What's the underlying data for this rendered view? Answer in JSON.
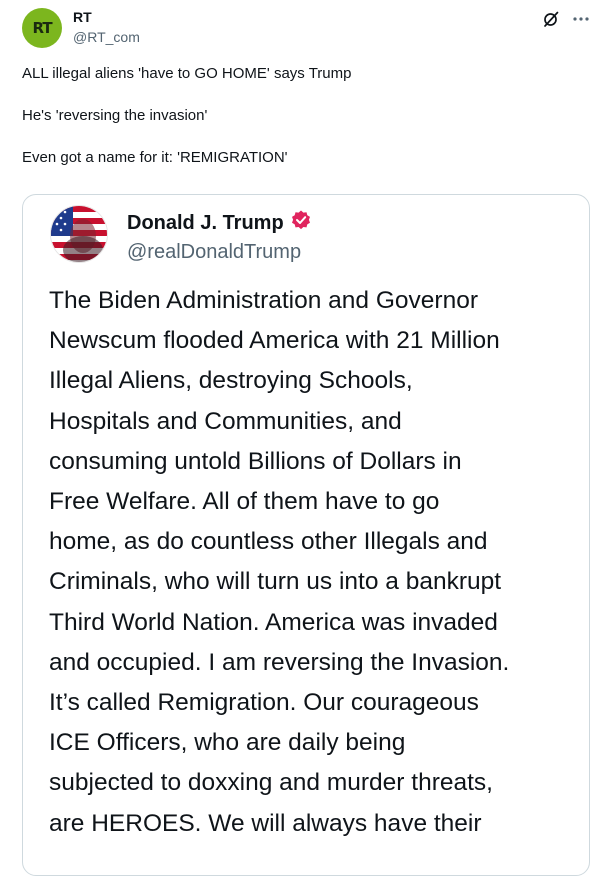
{
  "tweet": {
    "author_name": "RT",
    "author_handle": "@RT_com",
    "avatar_text": "RT",
    "avatar_color": "#7cb61e",
    "lines": [
      "ALL illegal aliens 'have to GO HOME' says Trump",
      "He's 'reversing the invasion'",
      "Even got a name for it: 'REMIGRATION'"
    ],
    "icons": [
      "grok-icon",
      "more-icon"
    ]
  },
  "quoted_post": {
    "author_name": "Donald J. Trump",
    "author_handle": "@realDonaldTrump",
    "verified_badge_color": "#e0245e",
    "body": "The Biden Administration and Governor\nNewscum flooded America with 21 Million\nIllegal Aliens, destroying Schools,\nHospitals and Communities, and\nconsuming untold Billions of Dollars in\nFree Welfare. All of them have to go\nhome, as do countless other Illegals and\nCriminals, who will turn us into a bankrupt\nThird World Nation. America was invaded\nand occupied. I am reversing the Invasion.\nIt’s called Remigration. Our courageous\nICE Officers, who are daily being\nsubjected to doxxing and murder threats,\nare HEROES. We will always have their"
  }
}
